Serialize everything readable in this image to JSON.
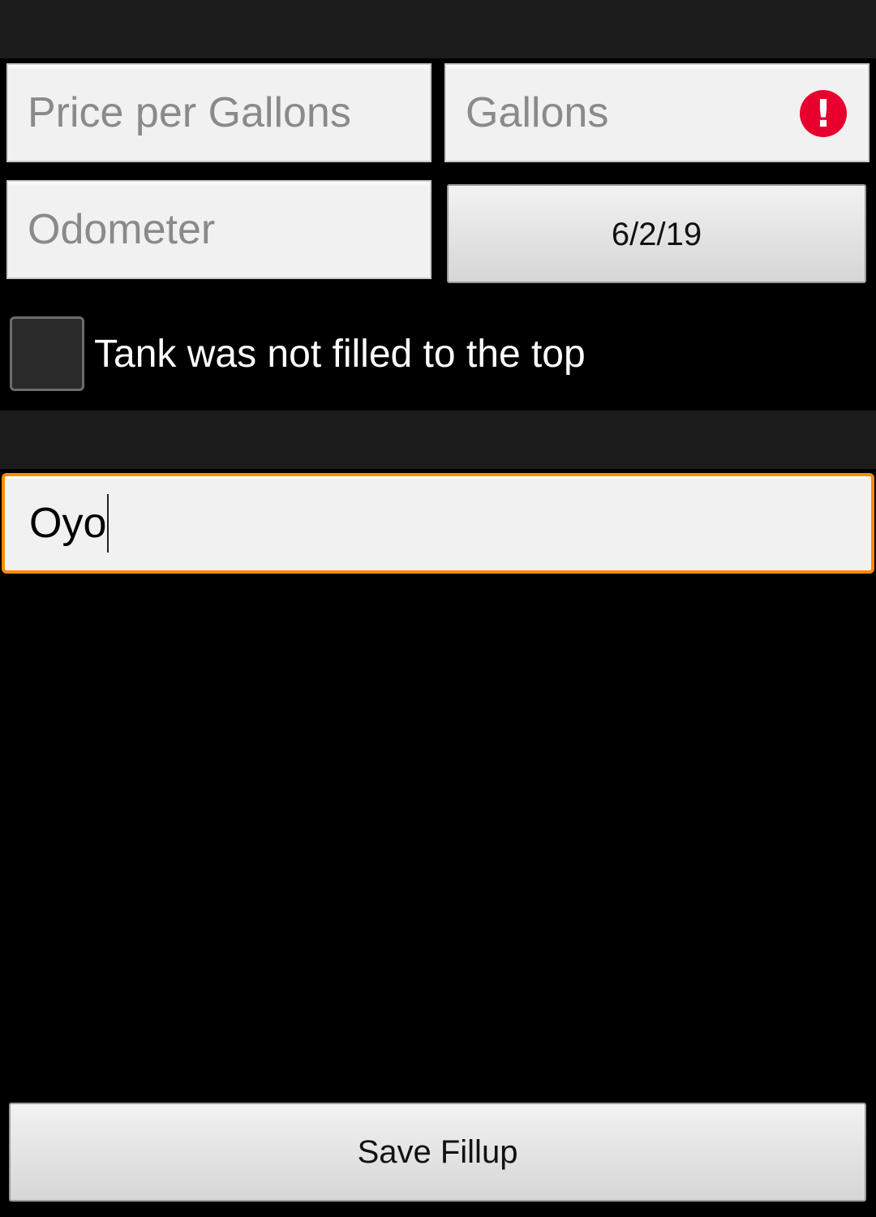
{
  "form": {
    "price_placeholder": "Price per Gallons",
    "gallons_placeholder": "Gallons",
    "gallons_error_icon": "exclamation-icon",
    "odometer_placeholder": "Odometer",
    "date_value": "6/2/19",
    "checkbox_label": "Tank was not filled to the top",
    "checkbox_checked": false,
    "note_value": "Oyo",
    "save_label": "Save Fillup"
  },
  "colors": {
    "focus_accent": "#ff8a00",
    "error": "#e8002f",
    "background": "#000000"
  }
}
